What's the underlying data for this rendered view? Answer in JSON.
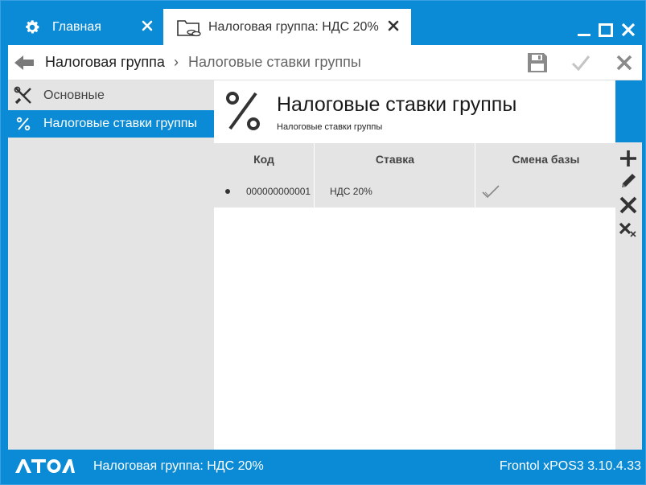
{
  "tabs": {
    "home": {
      "label": "Главная"
    },
    "active": {
      "label": "Налоговая группа: НДС 20%"
    }
  },
  "breadcrumb": {
    "parent": "Налоговая группа",
    "separator": "›",
    "current": "Налоговые ставки группы"
  },
  "nav": {
    "items": [
      {
        "label": "Основные",
        "icon": "tools-icon",
        "selected": false
      },
      {
        "label": "Налоговые ставки группы",
        "icon": "percent-icon",
        "selected": true
      }
    ]
  },
  "main": {
    "title": "Налоговые ставки группы",
    "subtitle": "Налоговые ставки группы"
  },
  "table": {
    "columns": [
      "Код",
      "Ставка",
      "Смена базы"
    ],
    "rows": [
      {
        "code": "000000000001",
        "rate": "НДС 20%",
        "base_change": true
      }
    ]
  },
  "statusbar": {
    "logo": "ATOЛ",
    "text": "Налоговая группа: НДС 20%",
    "version": "Frontol xPOS3 3.10.4.33"
  },
  "colors": {
    "accent": "#0b8bd6",
    "panel": "#e4e4e4",
    "icon_gray": "#7a7a7a"
  }
}
